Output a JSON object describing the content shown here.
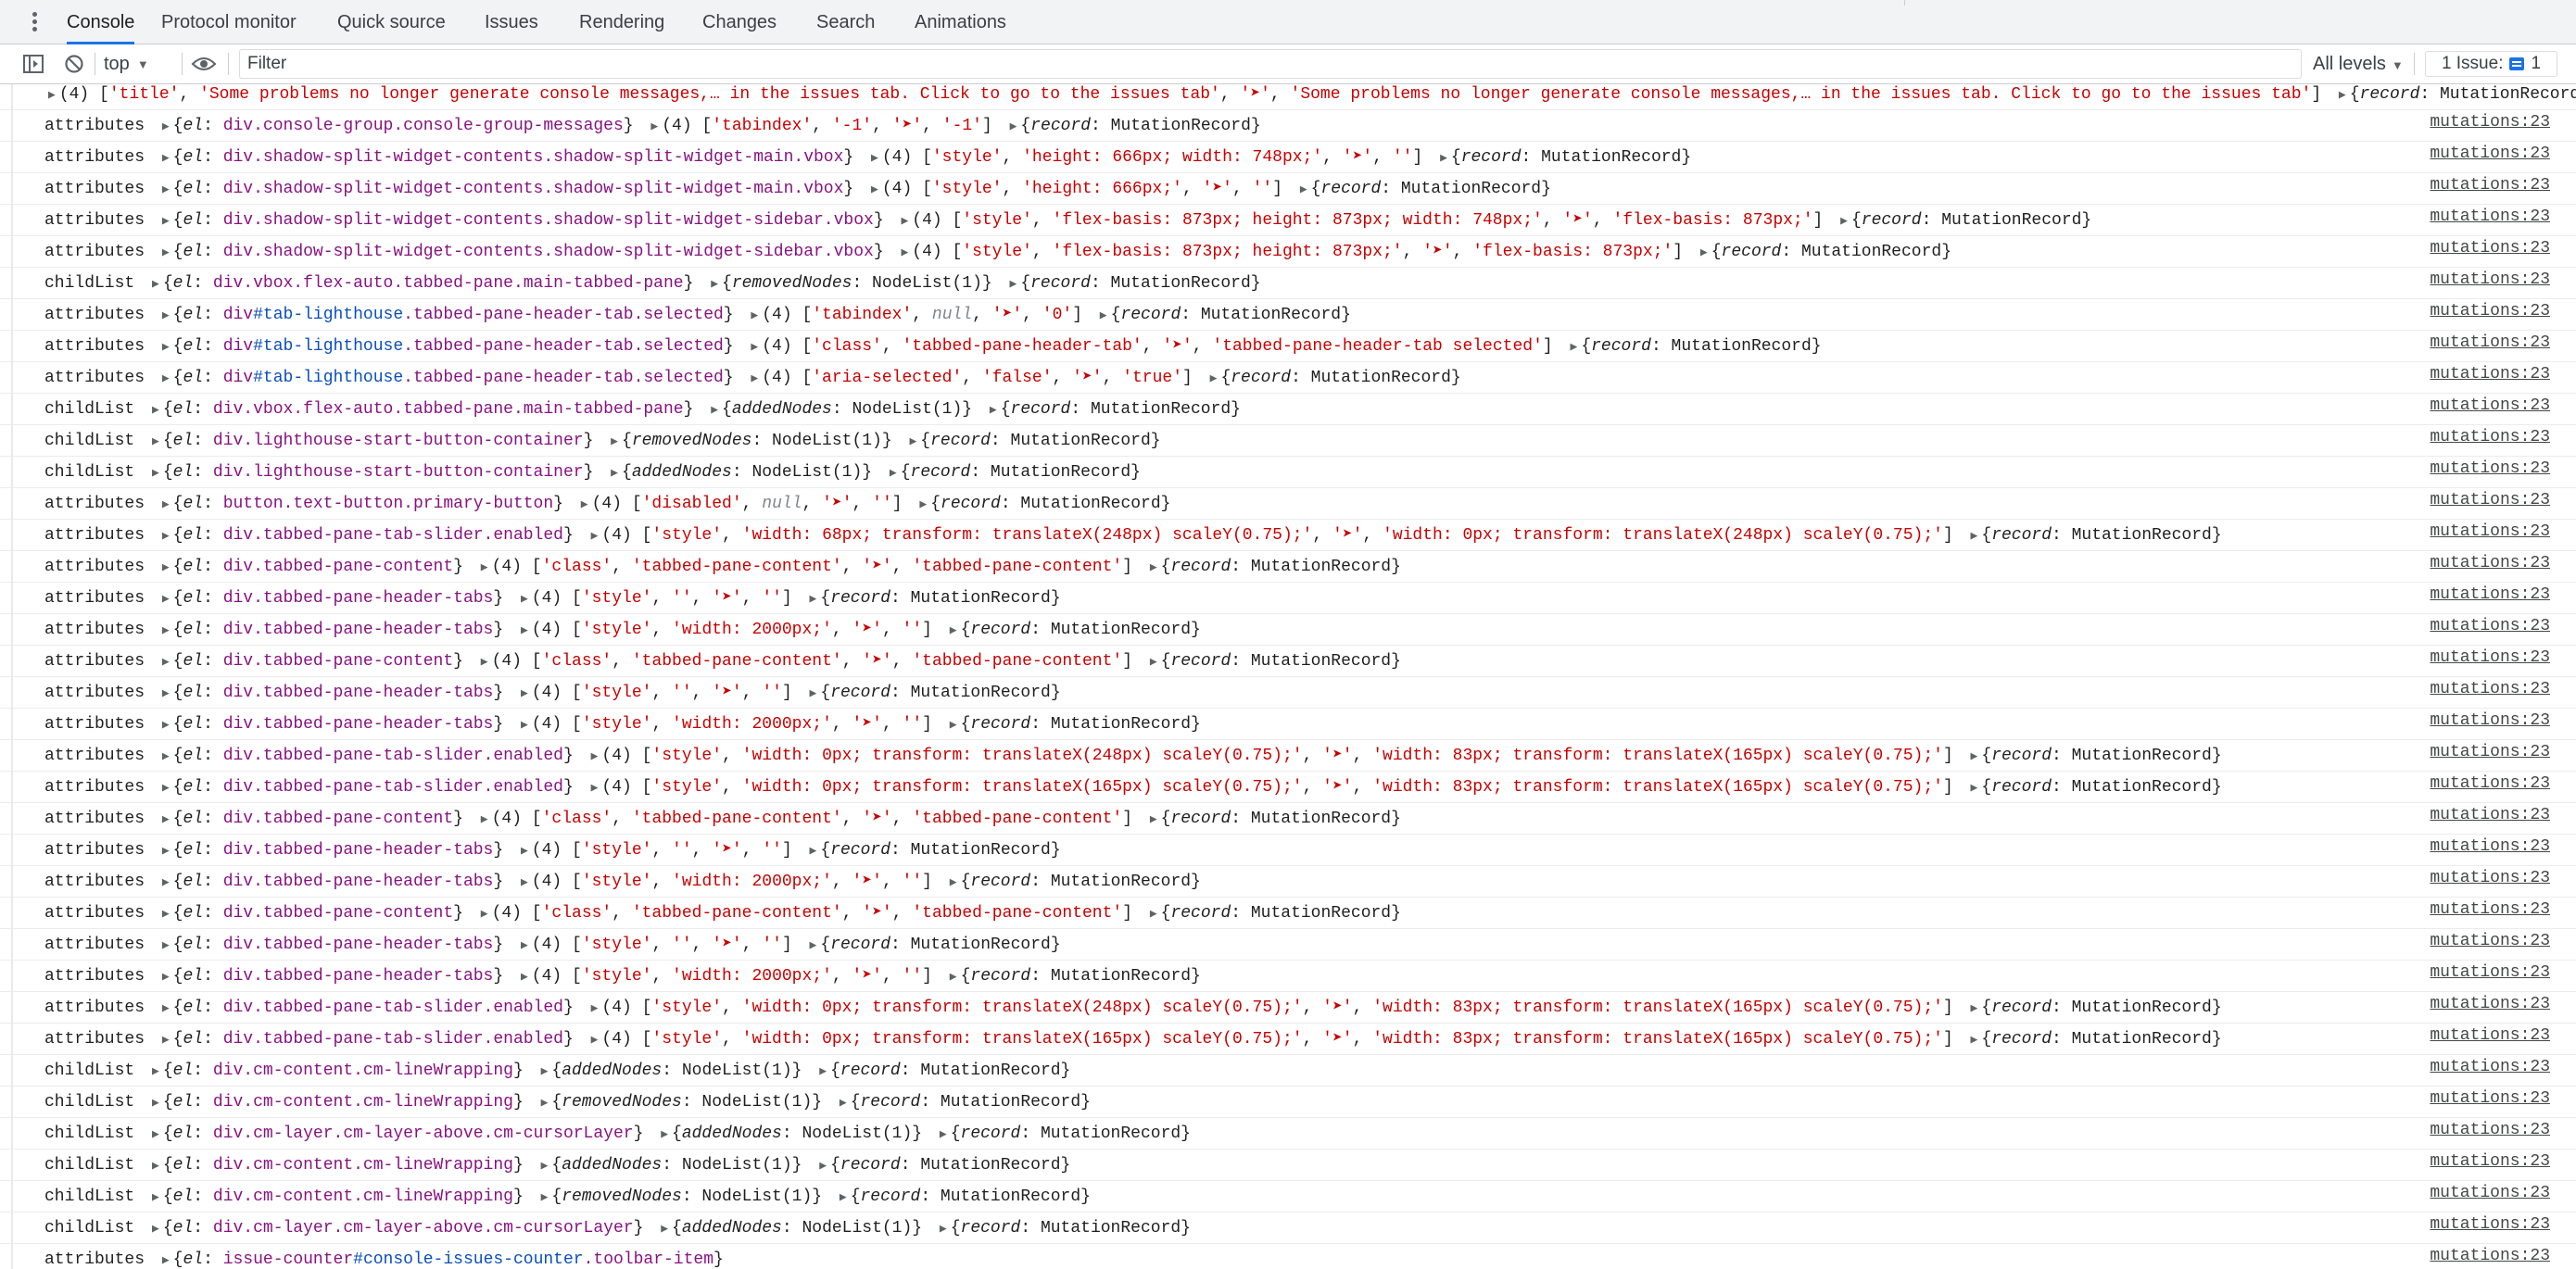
{
  "tabs": [
    "Console",
    "Protocol monitor",
    "Quick source",
    "Issues",
    "Rendering",
    "Changes",
    "Search",
    "Animations"
  ],
  "active_tab": "Console",
  "toolbar": {
    "context": "top",
    "filter_placeholder": "Filter",
    "levels": "All levels",
    "issues_label": "1 Issue:",
    "issues_count": "1"
  },
  "messages": [
    {
      "type": "",
      "el": "",
      "prop": "",
      "args": "(4) ['title', 'Some problems no longer generate console messages,… in the issues tab. Click to go to the issues tab', '➤', 'Some problems no longer generate console messages,… in the issues tab. Click to go to the issues tab']",
      "src": ""
    },
    {
      "type": "attributes",
      "el": "div.console-group.console-group-messages",
      "prop": "",
      "args": "(4) ['tabindex', '-1', '➤', '-1']",
      "src": "mutations:23"
    },
    {
      "type": "attributes",
      "el": "div.shadow-split-widget-contents.shadow-split-widget-main.vbox",
      "prop": "",
      "args": "(4) ['style', 'height: 666px; width: 748px;', '➤', '']",
      "src": "mutations:23"
    },
    {
      "type": "attributes",
      "el": "div.shadow-split-widget-contents.shadow-split-widget-main.vbox",
      "prop": "",
      "args": "(4) ['style', 'height: 666px;', '➤', '']",
      "src": "mutations:23"
    },
    {
      "type": "attributes",
      "el": "div.shadow-split-widget-contents.shadow-split-widget-sidebar.vbox",
      "prop": "",
      "args": "(4) ['style', 'flex-basis: 873px; height: 873px; width: 748px;', '➤', 'flex-basis: 873px;']",
      "src": "mutations:23"
    },
    {
      "type": "attributes",
      "el": "div.shadow-split-widget-contents.shadow-split-widget-sidebar.vbox",
      "prop": "",
      "args": "(4) ['style', 'flex-basis: 873px; height: 873px;', '➤', 'flex-basis: 873px;']",
      "src": "mutations:23"
    },
    {
      "type": "childList",
      "el": "div.vbox.flex-auto.tabbed-pane.main-tabbed-pane",
      "prop": "removedNodes",
      "args": "",
      "src": "mutations:23"
    },
    {
      "type": "attributes",
      "el": "div#tab-lighthouse.tabbed-pane-header-tab.selected",
      "prop": "",
      "args": "(4) ['tabindex', null, '➤', '0']",
      "src": "mutations:23"
    },
    {
      "type": "attributes",
      "el": "div#tab-lighthouse.tabbed-pane-header-tab.selected",
      "prop": "",
      "args": "(4) ['class', 'tabbed-pane-header-tab', '➤', 'tabbed-pane-header-tab selected']",
      "src": "mutations:23"
    },
    {
      "type": "attributes",
      "el": "div#tab-lighthouse.tabbed-pane-header-tab.selected",
      "prop": "",
      "args": "(4) ['aria-selected', 'false', '➤', 'true']",
      "src": "mutations:23"
    },
    {
      "type": "childList",
      "el": "div.vbox.flex-auto.tabbed-pane.main-tabbed-pane",
      "prop": "addedNodes",
      "args": "",
      "src": "mutations:23"
    },
    {
      "type": "childList",
      "el": "div.lighthouse-start-button-container",
      "prop": "removedNodes",
      "args": "",
      "src": "mutations:23"
    },
    {
      "type": "childList",
      "el": "div.lighthouse-start-button-container",
      "prop": "addedNodes",
      "args": "",
      "src": "mutations:23"
    },
    {
      "type": "attributes",
      "el": "button.text-button.primary-button",
      "prop": "",
      "args": "(4) ['disabled', null, '➤', '']",
      "src": "mutations:23"
    },
    {
      "type": "attributes",
      "el": "div.tabbed-pane-tab-slider.enabled",
      "prop": "",
      "args": "(4) ['style', 'width: 68px; transform: translateX(248px) scaleY(0.75);', '➤', 'width: 0px; transform: translateX(248px) scaleY(0.75);']",
      "src": "mutations:23"
    },
    {
      "type": "attributes",
      "el": "div.tabbed-pane-content",
      "prop": "",
      "args": "(4) ['class', 'tabbed-pane-content', '➤', 'tabbed-pane-content']",
      "src": "mutations:23"
    },
    {
      "type": "attributes",
      "el": "div.tabbed-pane-header-tabs",
      "prop": "",
      "args": "(4) ['style', '', '➤', '']",
      "src": "mutations:23"
    },
    {
      "type": "attributes",
      "el": "div.tabbed-pane-header-tabs",
      "prop": "",
      "args": "(4) ['style', 'width: 2000px;', '➤', '']",
      "src": "mutations:23"
    },
    {
      "type": "attributes",
      "el": "div.tabbed-pane-content",
      "prop": "",
      "args": "(4) ['class', 'tabbed-pane-content', '➤', 'tabbed-pane-content']",
      "src": "mutations:23"
    },
    {
      "type": "attributes",
      "el": "div.tabbed-pane-header-tabs",
      "prop": "",
      "args": "(4) ['style', '', '➤', '']",
      "src": "mutations:23"
    },
    {
      "type": "attributes",
      "el": "div.tabbed-pane-header-tabs",
      "prop": "",
      "args": "(4) ['style', 'width: 2000px;', '➤', '']",
      "src": "mutations:23"
    },
    {
      "type": "attributes",
      "el": "div.tabbed-pane-tab-slider.enabled",
      "prop": "",
      "args": "(4) ['style', 'width: 0px; transform: translateX(248px) scaleY(0.75);', '➤', 'width: 83px; transform: translateX(165px) scaleY(0.75);']",
      "src": "mutations:23"
    },
    {
      "type": "attributes",
      "el": "div.tabbed-pane-tab-slider.enabled",
      "prop": "",
      "args": "(4) ['style', 'width: 0px; transform: translateX(165px) scaleY(0.75);', '➤', 'width: 83px; transform: translateX(165px) scaleY(0.75);']",
      "src": "mutations:23"
    },
    {
      "type": "attributes",
      "el": "div.tabbed-pane-content",
      "prop": "",
      "args": "(4) ['class', 'tabbed-pane-content', '➤', 'tabbed-pane-content']",
      "src": "mutations:23"
    },
    {
      "type": "attributes",
      "el": "div.tabbed-pane-header-tabs",
      "prop": "",
      "args": "(4) ['style', '', '➤', '']",
      "src": "mutations:23"
    },
    {
      "type": "attributes",
      "el": "div.tabbed-pane-header-tabs",
      "prop": "",
      "args": "(4) ['style', 'width: 2000px;', '➤', '']",
      "src": "mutations:23"
    },
    {
      "type": "attributes",
      "el": "div.tabbed-pane-content",
      "prop": "",
      "args": "(4) ['class', 'tabbed-pane-content', '➤', 'tabbed-pane-content']",
      "src": "mutations:23"
    },
    {
      "type": "attributes",
      "el": "div.tabbed-pane-header-tabs",
      "prop": "",
      "args": "(4) ['style', '', '➤', '']",
      "src": "mutations:23"
    },
    {
      "type": "attributes",
      "el": "div.tabbed-pane-header-tabs",
      "prop": "",
      "args": "(4) ['style', 'width: 2000px;', '➤', '']",
      "src": "mutations:23"
    },
    {
      "type": "attributes",
      "el": "div.tabbed-pane-tab-slider.enabled",
      "prop": "",
      "args": "(4) ['style', 'width: 0px; transform: translateX(248px) scaleY(0.75);', '➤', 'width: 83px; transform: translateX(165px) scaleY(0.75);']",
      "src": "mutations:23"
    },
    {
      "type": "attributes",
      "el": "div.tabbed-pane-tab-slider.enabled",
      "prop": "",
      "args": "(4) ['style', 'width: 0px; transform: translateX(165px) scaleY(0.75);', '➤', 'width: 83px; transform: translateX(165px) scaleY(0.75);']",
      "src": "mutations:23"
    },
    {
      "type": "childList",
      "el": "div.cm-content.cm-lineWrapping",
      "prop": "addedNodes",
      "args": "",
      "src": "mutations:23"
    },
    {
      "type": "childList",
      "el": "div.cm-content.cm-lineWrapping",
      "prop": "removedNodes",
      "args": "",
      "src": "mutations:23"
    },
    {
      "type": "childList",
      "el": "div.cm-layer.cm-layer-above.cm-cursorLayer",
      "prop": "addedNodes",
      "args": "",
      "src": "mutations:23"
    },
    {
      "type": "childList",
      "el": "div.cm-content.cm-lineWrapping",
      "prop": "addedNodes",
      "args": "",
      "src": "mutations:23"
    },
    {
      "type": "childList",
      "el": "div.cm-content.cm-lineWrapping",
      "prop": "removedNodes",
      "args": "",
      "src": "mutations:23"
    },
    {
      "type": "childList",
      "el": "div.cm-layer.cm-layer-above.cm-cursorLayer",
      "prop": "addedNodes",
      "args": "",
      "src": "mutations:23"
    },
    {
      "type": "attributes",
      "el": "issue-counter#console-issues-counter.toolbar-item",
      "prop": "",
      "args": "",
      "src": "mutations:23",
      "truncated": true
    }
  ],
  "labels": {
    "el_key": "el",
    "record_key": "record",
    "record_type": "MutationRecord",
    "nodelist": "NodeList(1)"
  },
  "colors": {
    "accent": "#1a73e8",
    "string": "#c80000",
    "class_name": "#881280",
    "id_selector": "#0b4fbd"
  }
}
